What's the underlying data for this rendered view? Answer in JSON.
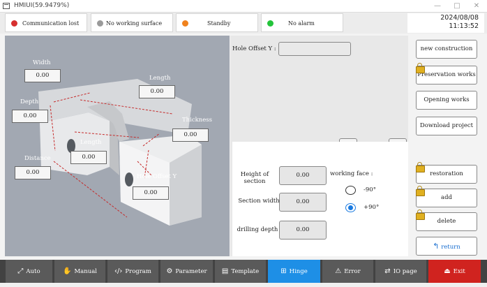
{
  "window": {
    "title": "HMIUI(59.9479%)",
    "controls": [
      "—",
      "□",
      "✕"
    ]
  },
  "status": {
    "items": [
      {
        "label": "Communication lost",
        "color": "#d62f2f"
      },
      {
        "label": "No working surface",
        "color": "#9a9a9a"
      },
      {
        "label": "Standby",
        "color": "#f0821e"
      },
      {
        "label": "No alarm",
        "color": "#23c43a"
      }
    ],
    "date": "2024/08/08",
    "time": "11:13:52"
  },
  "illustration": {
    "labels": {
      "width": "Width",
      "length_top": "Length",
      "depth": "Depth",
      "thickness": "Thickness",
      "length_mid": "Length",
      "distance": "Distance",
      "hole_offset_y": "Hole Offset Y"
    },
    "values": {
      "width": "0.00",
      "length_top": "0.00",
      "depth": "0.00",
      "thickness": "0.00",
      "length_mid": "0.00",
      "distance": "0.00",
      "hole_offset_y": "0.00"
    }
  },
  "hole_offset": {
    "label": "Hole Offset Y :",
    "value": ""
  },
  "params": {
    "height_of_section": {
      "label": "Height of section",
      "value": "0.00"
    },
    "section_width": {
      "label": "Section width",
      "value": "0.00"
    },
    "drilling_depth": {
      "label": "drilling depth",
      "value": "0.00"
    },
    "working_face_label": "working face :",
    "faces": [
      {
        "label": "-90°",
        "selected": false
      },
      {
        "label": "+90°",
        "selected": true
      }
    ]
  },
  "actions": {
    "new_construction": "new construction",
    "preservation_works": "Preservation works",
    "opening_works": "Opening works",
    "download_project": "Download project",
    "restoration": "restoration",
    "add": "add",
    "delete": "delete",
    "return": "return"
  },
  "nav": [
    {
      "label": "Auto",
      "icon": "auto-icon"
    },
    {
      "label": "Manual",
      "icon": "manual-icon"
    },
    {
      "label": "Program",
      "icon": "program-icon"
    },
    {
      "label": "Parameter",
      "icon": "parameter-icon"
    },
    {
      "label": "Template",
      "icon": "template-icon"
    },
    {
      "label": "Hinge",
      "icon": "hinge-icon"
    },
    {
      "label": "Error",
      "icon": "error-icon"
    },
    {
      "label": "IO page",
      "icon": "io-icon"
    },
    {
      "label": "Exit",
      "icon": "exit-icon"
    }
  ],
  "colors": {
    "active_tab": "#1e8fe6",
    "exit": "#d0231f",
    "nav_bg": "#5a5a5a"
  }
}
